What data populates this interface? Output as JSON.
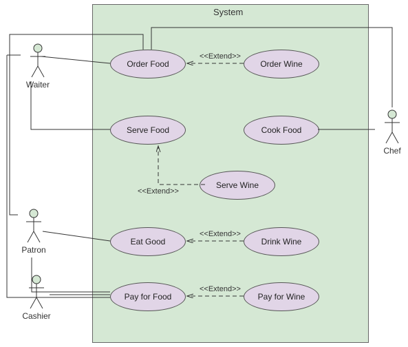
{
  "system": {
    "title": "System"
  },
  "actors": {
    "waiter": "Waiter",
    "chef": "Chef",
    "patron": "Patron",
    "cashier": "Cashier"
  },
  "usecases": {
    "order_food": "Order Food",
    "order_wine": "Order Wine",
    "serve_food": "Serve Food",
    "cook_food": "Cook Food",
    "serve_wine": "Serve Wine",
    "eat_good": "Eat Good",
    "drink_wine": "Drink Wine",
    "pay_for_food": "Pay for Food",
    "pay_for_wine": "Pay for Wine"
  },
  "stereotypes": {
    "extend1": "<<Extend>>",
    "extend2": "<<Extend>>",
    "extend3": "<<Extend>>",
    "extend4": "<<Extend>>"
  },
  "chart_data": {
    "type": "uml-use-case",
    "system": "System",
    "actors": [
      "Waiter",
      "Chef",
      "Patron",
      "Cashier"
    ],
    "use_cases": [
      "Order Food",
      "Order Wine",
      "Serve Food",
      "Cook Food",
      "Serve Wine",
      "Eat Good",
      "Drink Wine",
      "Pay for Food",
      "Pay for Wine"
    ],
    "associations": [
      {
        "actor": "Waiter",
        "use_case": "Order Food"
      },
      {
        "actor": "Waiter",
        "use_case": "Serve Food"
      },
      {
        "actor": "Waiter",
        "use_case": "Pay for Food"
      },
      {
        "actor": "Chef",
        "use_case": "Order Food"
      },
      {
        "actor": "Chef",
        "use_case": "Cook Food"
      },
      {
        "actor": "Patron",
        "use_case": "Order Food"
      },
      {
        "actor": "Patron",
        "use_case": "Eat Good"
      },
      {
        "actor": "Patron",
        "use_case": "Pay for Food"
      },
      {
        "actor": "Cashier",
        "use_case": "Pay for Food"
      }
    ],
    "extends": [
      {
        "from": "Order Wine",
        "to": "Order Food"
      },
      {
        "from": "Serve Wine",
        "to": "Serve Food"
      },
      {
        "from": "Drink Wine",
        "to": "Eat Good"
      },
      {
        "from": "Pay for Wine",
        "to": "Pay for Food"
      }
    ]
  }
}
